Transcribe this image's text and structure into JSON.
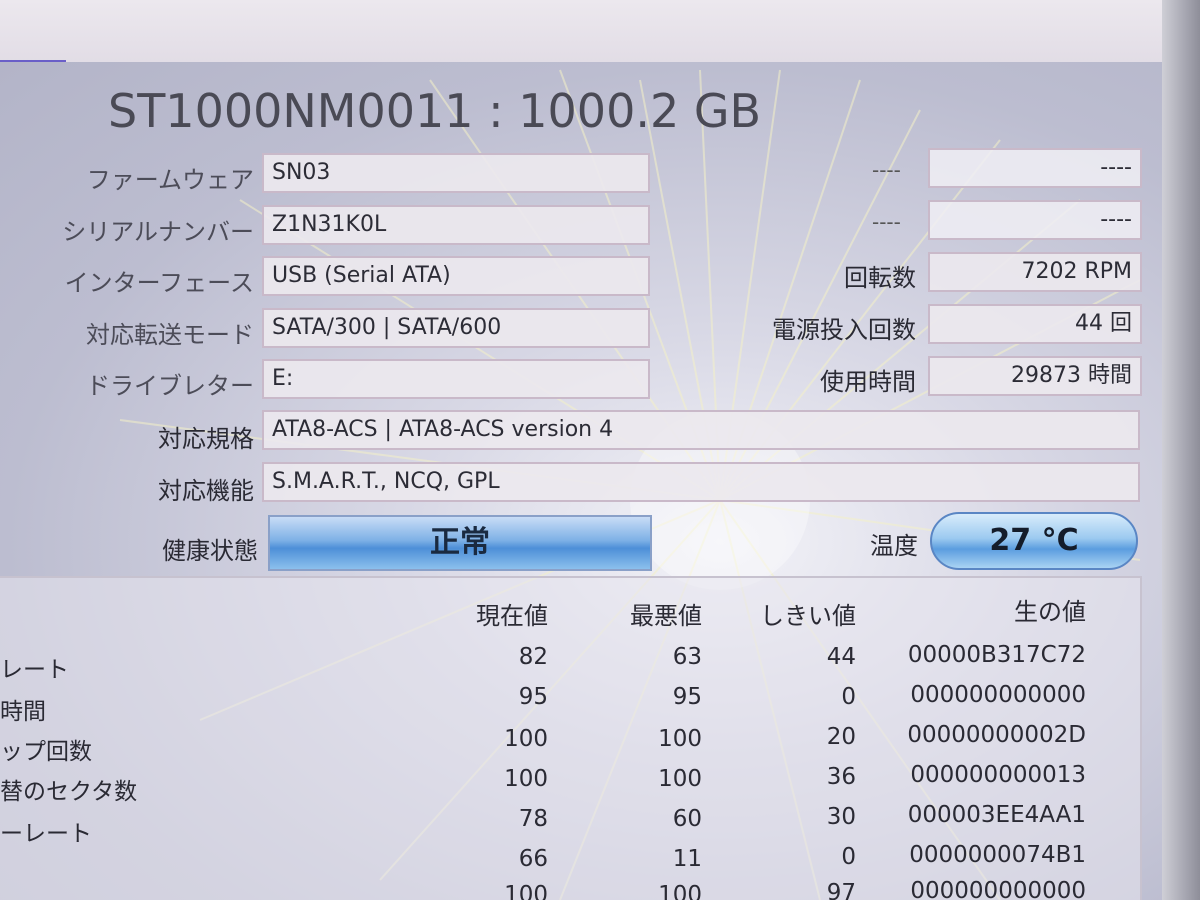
{
  "drive": {
    "title": "ST1000NM0011 : 1000.2 GB"
  },
  "info_left": [
    {
      "label": "ファームウェア",
      "value": "SN03"
    },
    {
      "label": "シリアルナンバー",
      "value": "Z1N31K0L"
    },
    {
      "label": "インターフェース",
      "value": "USB (Serial ATA)"
    },
    {
      "label": "対応転送モード",
      "value": "SATA/300 | SATA/600"
    },
    {
      "label": "ドライブレター",
      "value": "E:"
    },
    {
      "label": "対応規格",
      "value": "ATA8-ACS | ATA8-ACS version 4"
    },
    {
      "label": "対応機能",
      "value": "S.M.A.R.T., NCQ, GPL"
    }
  ],
  "info_right": [
    {
      "label": "----",
      "value": "----"
    },
    {
      "label": "----",
      "value": "----"
    },
    {
      "label": "回転数",
      "value": "7202 RPM"
    },
    {
      "label": "電源投入回数",
      "value": "44 回"
    },
    {
      "label": "使用時間",
      "value": "29873 時間"
    }
  ],
  "health": {
    "label": "健康状態",
    "value": "正常"
  },
  "temperature": {
    "label": "温度",
    "value": "27 °C"
  },
  "smart": {
    "headers": [
      "現在値",
      "最悪値",
      "しきい値",
      "生の値"
    ],
    "rows": [
      {
        "name": "レート",
        "current": "82",
        "worst": "63",
        "threshold": "44",
        "raw": "00000B317C72"
      },
      {
        "name": "時間",
        "current": "95",
        "worst": "95",
        "threshold": "0",
        "raw": "000000000000"
      },
      {
        "name": "ップ回数",
        "current": "100",
        "worst": "100",
        "threshold": "20",
        "raw": "00000000002D"
      },
      {
        "name": "替のセクタ数",
        "current": "100",
        "worst": "100",
        "threshold": "36",
        "raw": "000000000013"
      },
      {
        "name": "ーレート",
        "current": "78",
        "worst": "60",
        "threshold": "30",
        "raw": "000003EE4AA1"
      },
      {
        "name": "",
        "current": "66",
        "worst": "11",
        "threshold": "0",
        "raw": "0000000074B1"
      },
      {
        "name": "",
        "current": "100",
        "worst": "100",
        "threshold": "97",
        "raw": "000000000000"
      }
    ]
  },
  "colors": {
    "panel": "#c9c9d6",
    "health_blue": "#4d8fd8",
    "accent": "#6a5fc8"
  }
}
